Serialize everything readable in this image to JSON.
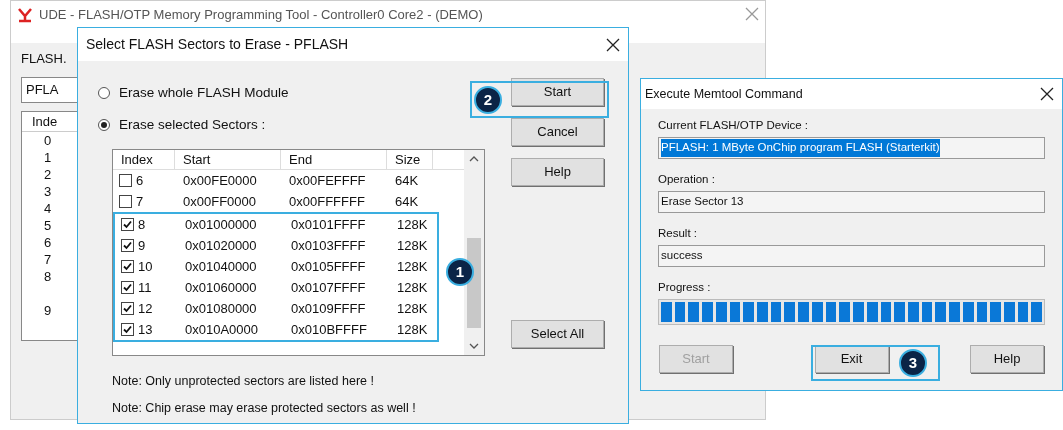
{
  "background_window": {
    "title": "UDE - FLASH/OTP Memory Programming Tool - Controller0 Core2 - (DEMO)",
    "group_label": "FLASH.",
    "field_value": "PFLA",
    "column_header": "Inde",
    "row_indices": [
      "0",
      "1",
      "2",
      "3",
      "4",
      "5",
      "6",
      "7",
      "8",
      "9"
    ]
  },
  "erase_dialog": {
    "title": "Select FLASH Sectors to Erase - PFLASH",
    "options": [
      {
        "label": "Erase whole FLASH Module",
        "selected": false
      },
      {
        "label": "Erase selected Sectors :",
        "selected": true
      }
    ],
    "columns": [
      "Index",
      "Start",
      "End",
      "Size"
    ],
    "rows": [
      {
        "index": "6",
        "start": "0x00FE0000",
        "end": "0x00FEFFFF",
        "size": "64K",
        "checked": false
      },
      {
        "index": "7",
        "start": "0x00FF0000",
        "end": "0x00FFFFFF",
        "size": "64K",
        "checked": false
      },
      {
        "index": "8",
        "start": "0x01000000",
        "end": "0x0101FFFF",
        "size": "128K",
        "checked": true
      },
      {
        "index": "9",
        "start": "0x01020000",
        "end": "0x0103FFFF",
        "size": "128K",
        "checked": true
      },
      {
        "index": "10",
        "start": "0x01040000",
        "end": "0x0105FFFF",
        "size": "128K",
        "checked": true
      },
      {
        "index": "11",
        "start": "0x01060000",
        "end": "0x0107FFFF",
        "size": "128K",
        "checked": true
      },
      {
        "index": "12",
        "start": "0x01080000",
        "end": "0x0109FFFF",
        "size": "128K",
        "checked": true
      },
      {
        "index": "13",
        "start": "0x010A0000",
        "end": "0x010BFFFF",
        "size": "128K",
        "checked": true
      }
    ],
    "buttons": [
      "Start",
      "Cancel",
      "Help",
      "Select All"
    ],
    "notes": [
      "Note: Only unprotected sectors are listed here !",
      "Note: Chip erase may erase protected sectors as well !"
    ]
  },
  "memtool_dialog": {
    "title": "Execute Memtool Command",
    "fields": [
      {
        "label": "Current FLASH/OTP Device :",
        "value": "PFLASH: 1 MByte OnChip program FLASH (Starterkit)",
        "highlighted": true
      },
      {
        "label": "Operation :",
        "value": "Erase Sector 13",
        "highlighted": false
      },
      {
        "label": "Result :",
        "value": "success",
        "highlighted": false
      }
    ],
    "progress": {
      "label": "Progress :"
    },
    "buttons": [
      {
        "label": "Start",
        "disabled": true
      },
      {
        "label": "Exit",
        "disabled": false
      },
      {
        "label": "Help",
        "disabled": false
      }
    ]
  },
  "annotations": [
    "1",
    "2",
    "3"
  ]
}
